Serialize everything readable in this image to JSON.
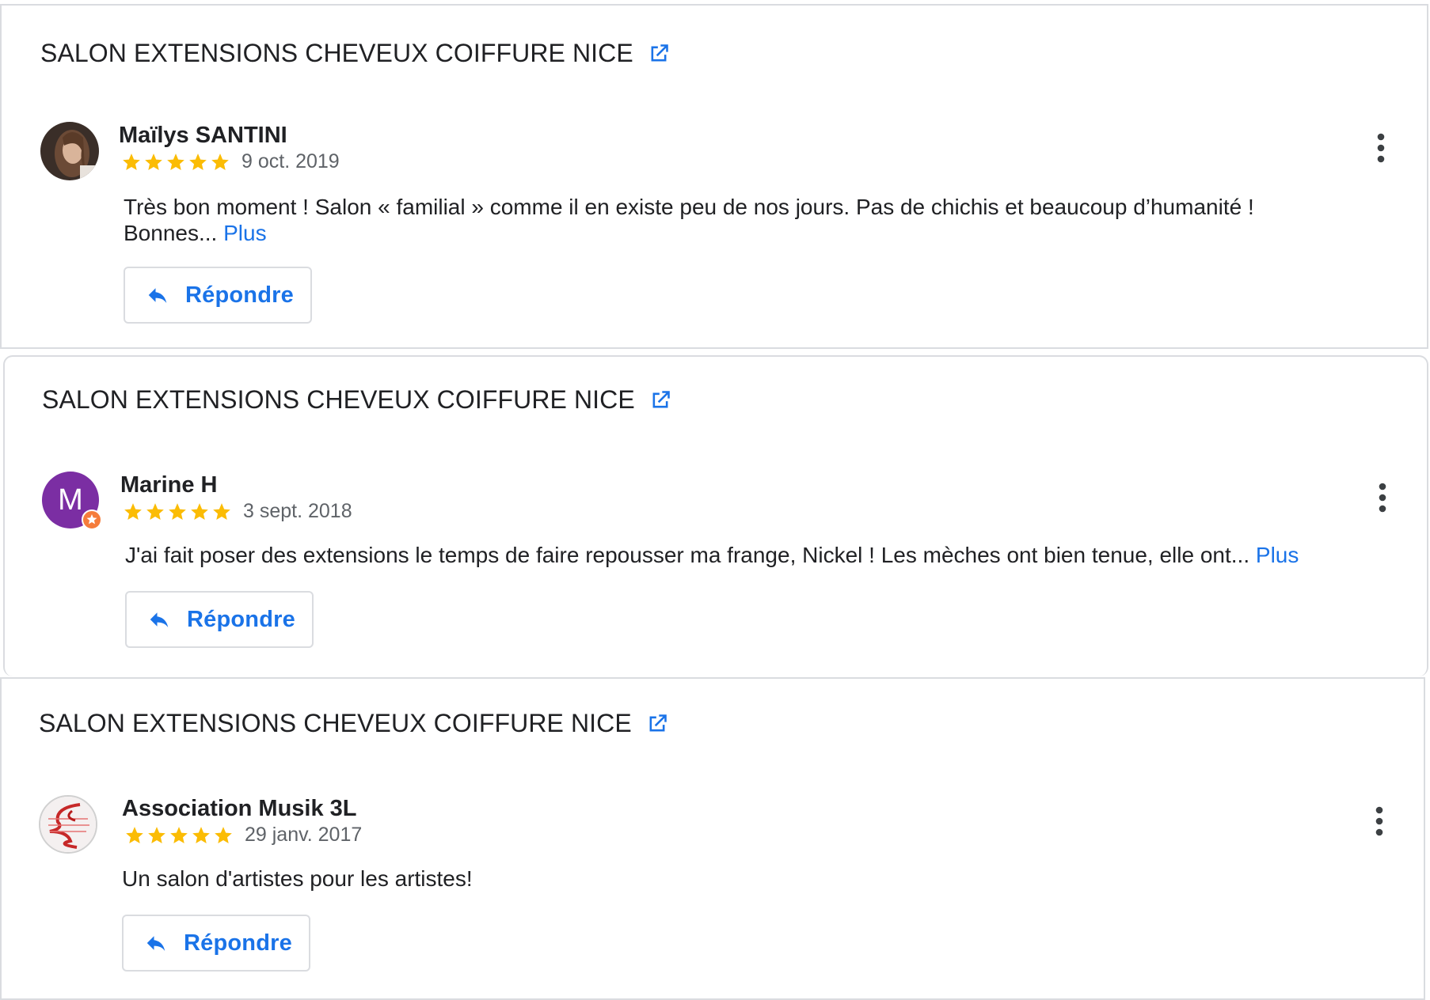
{
  "colors": {
    "accent": "#1a73e8",
    "star": "#fbbc04",
    "border": "#dadce0",
    "text": "#202124",
    "muted": "#5f6368",
    "avatar_marine": "#7b2ea3",
    "local_guide_badge": "#f57c3b"
  },
  "icons": {
    "external_link": "external-link-icon",
    "reply": "reply-arrow-icon",
    "more": "more-vert-icon",
    "star": "star-icon"
  },
  "reviews": [
    {
      "place_name": "SALON EXTENSIONS CHEVEUX COIFFURE NICE",
      "reviewer": "Maïlys SANTINI",
      "rating": 5,
      "date": "9 oct. 2019",
      "text": "Très bon moment ! Salon « familial » comme il en existe peu de nos jours. Pas de chichis et beaucoup d’humanité ! Bonnes...",
      "more_label": "Plus",
      "reply_label": "Répondre"
    },
    {
      "place_name": "SALON EXTENSIONS CHEVEUX COIFFURE NICE",
      "reviewer": "Marine H",
      "avatar_letter": "M",
      "rating": 5,
      "date": "3 sept. 2018",
      "text": "J'ai fait poser des extensions le temps de faire repousser ma frange, Nickel ! Les mèches ont bien tenue, elle ont...",
      "more_label": "Plus",
      "reply_label": "Répondre"
    },
    {
      "place_name": "SALON EXTENSIONS CHEVEUX COIFFURE NICE",
      "reviewer": "Association Musik 3L",
      "rating": 5,
      "date": "29 janv. 2017",
      "text": "Un salon d'artistes pour les artistes!",
      "more_label": "",
      "reply_label": "Répondre"
    }
  ]
}
